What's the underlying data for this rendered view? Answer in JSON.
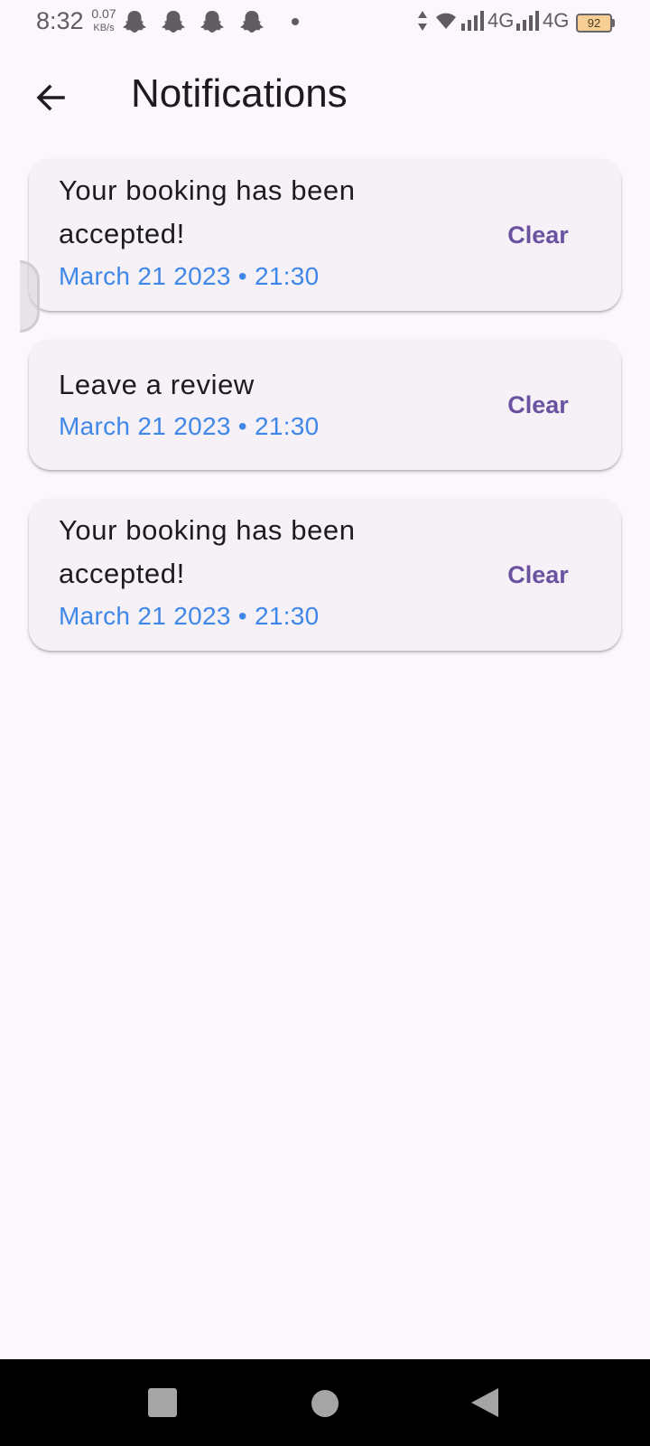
{
  "status_bar": {
    "time": "8:32",
    "speed_value": "0.07",
    "speed_unit": "KB/s",
    "network_1": "4G",
    "network_2": "4G",
    "battery": "92",
    "icons": [
      "snapchat-ghost-icon",
      "snapchat-ghost-icon",
      "snapchat-ghost-icon",
      "snapchat-ghost-icon",
      "dot-icon",
      "data-arrows-icon",
      "wifi-icon",
      "signal-icon",
      "signal-icon",
      "battery-icon"
    ]
  },
  "app_bar": {
    "back_icon": "arrow-left-icon",
    "title": "Notifications"
  },
  "notifications": [
    {
      "message": "Your booking has been accepted!",
      "timestamp": "March 21 2023 • 21:30",
      "action": "Clear"
    },
    {
      "message": "Leave a review",
      "timestamp": "March 21 2023 • 21:30",
      "action": "Clear"
    },
    {
      "message": "Your booking has been accepted!",
      "timestamp": "March 21 2023 • 21:30",
      "action": "Clear"
    }
  ],
  "nav_bar": {
    "icons": [
      "recents-square-icon",
      "home-circle-icon",
      "back-triangle-icon"
    ]
  },
  "colors": {
    "background": "#fcf6fd",
    "card": "#f5f1f6",
    "timestamp": "#3f87e8",
    "action": "#6a52a1",
    "text": "#1e1b20"
  }
}
